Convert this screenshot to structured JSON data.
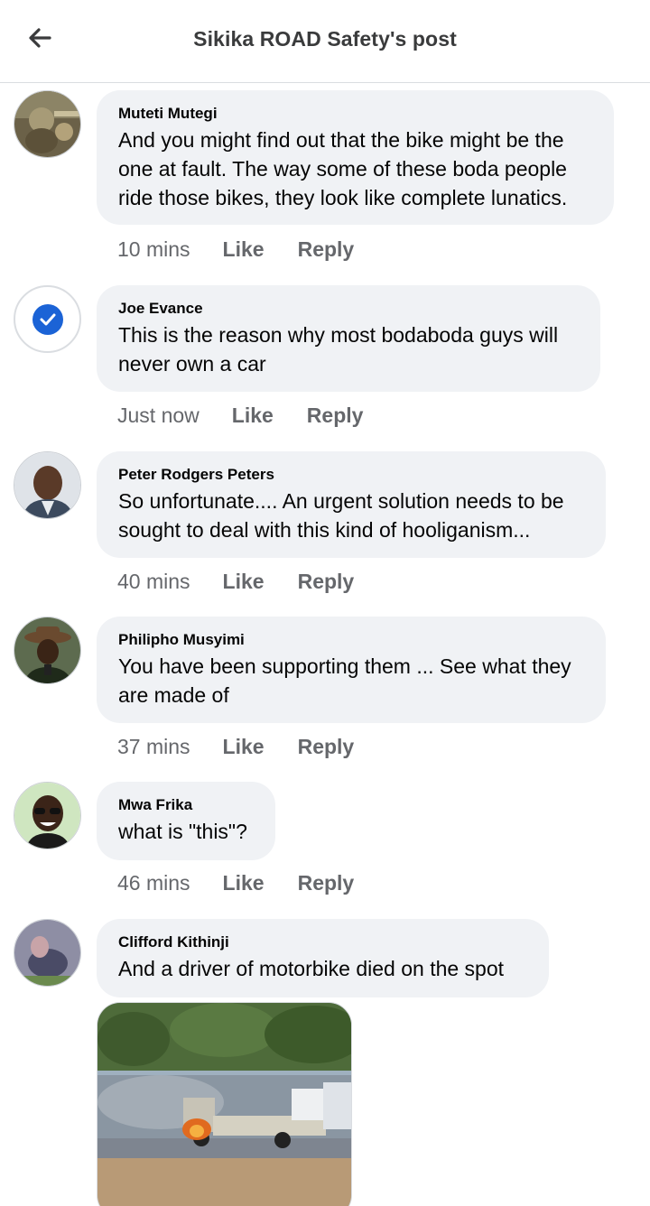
{
  "header": {
    "title": "Sikika ROAD Safety's post",
    "back_icon": "arrow-left-icon"
  },
  "comments": [
    {
      "author": "Muteti Mutegi",
      "lines": [
        "And you might find out that the bike might be the",
        "one at fault. The way some of these boda people",
        "ride those bikes, they look like complete lunatics."
      ],
      "time": "10 mins",
      "like": "Like",
      "reply": "Reply"
    },
    {
      "author": "Joe Evance",
      "lines": [
        "This is the reason why most bodaboda guys will",
        "never own a car"
      ],
      "time": "Just now",
      "like": "Like",
      "reply": "Reply"
    },
    {
      "author": "Peter Rodgers Peters",
      "lines": [
        "So unfortunate.... An urgent solution needs to be",
        "sought to deal with this kind of hooliganism..."
      ],
      "time": "40 mins",
      "like": "Like",
      "reply": "Reply"
    },
    {
      "author": "Philipho Musyimi",
      "lines": [
        "You have been supporting them ... See what they",
        "are made of"
      ],
      "time": "37 mins",
      "like": "Like",
      "reply": "Reply"
    },
    {
      "author": "Mwa Frika",
      "lines": [
        "what is \"this\"?"
      ],
      "time": "46 mins",
      "like": "Like",
      "reply": "Reply"
    },
    {
      "author": "Clifford Kithinji",
      "lines": [
        "And a driver of motorbike died on the spot"
      ],
      "attachment": "photo of burning pickup truck on roadside"
    }
  ],
  "colors": {
    "bubble": "#f0f2f5",
    "meta": "#65676b",
    "accent": "#1b63d6"
  }
}
